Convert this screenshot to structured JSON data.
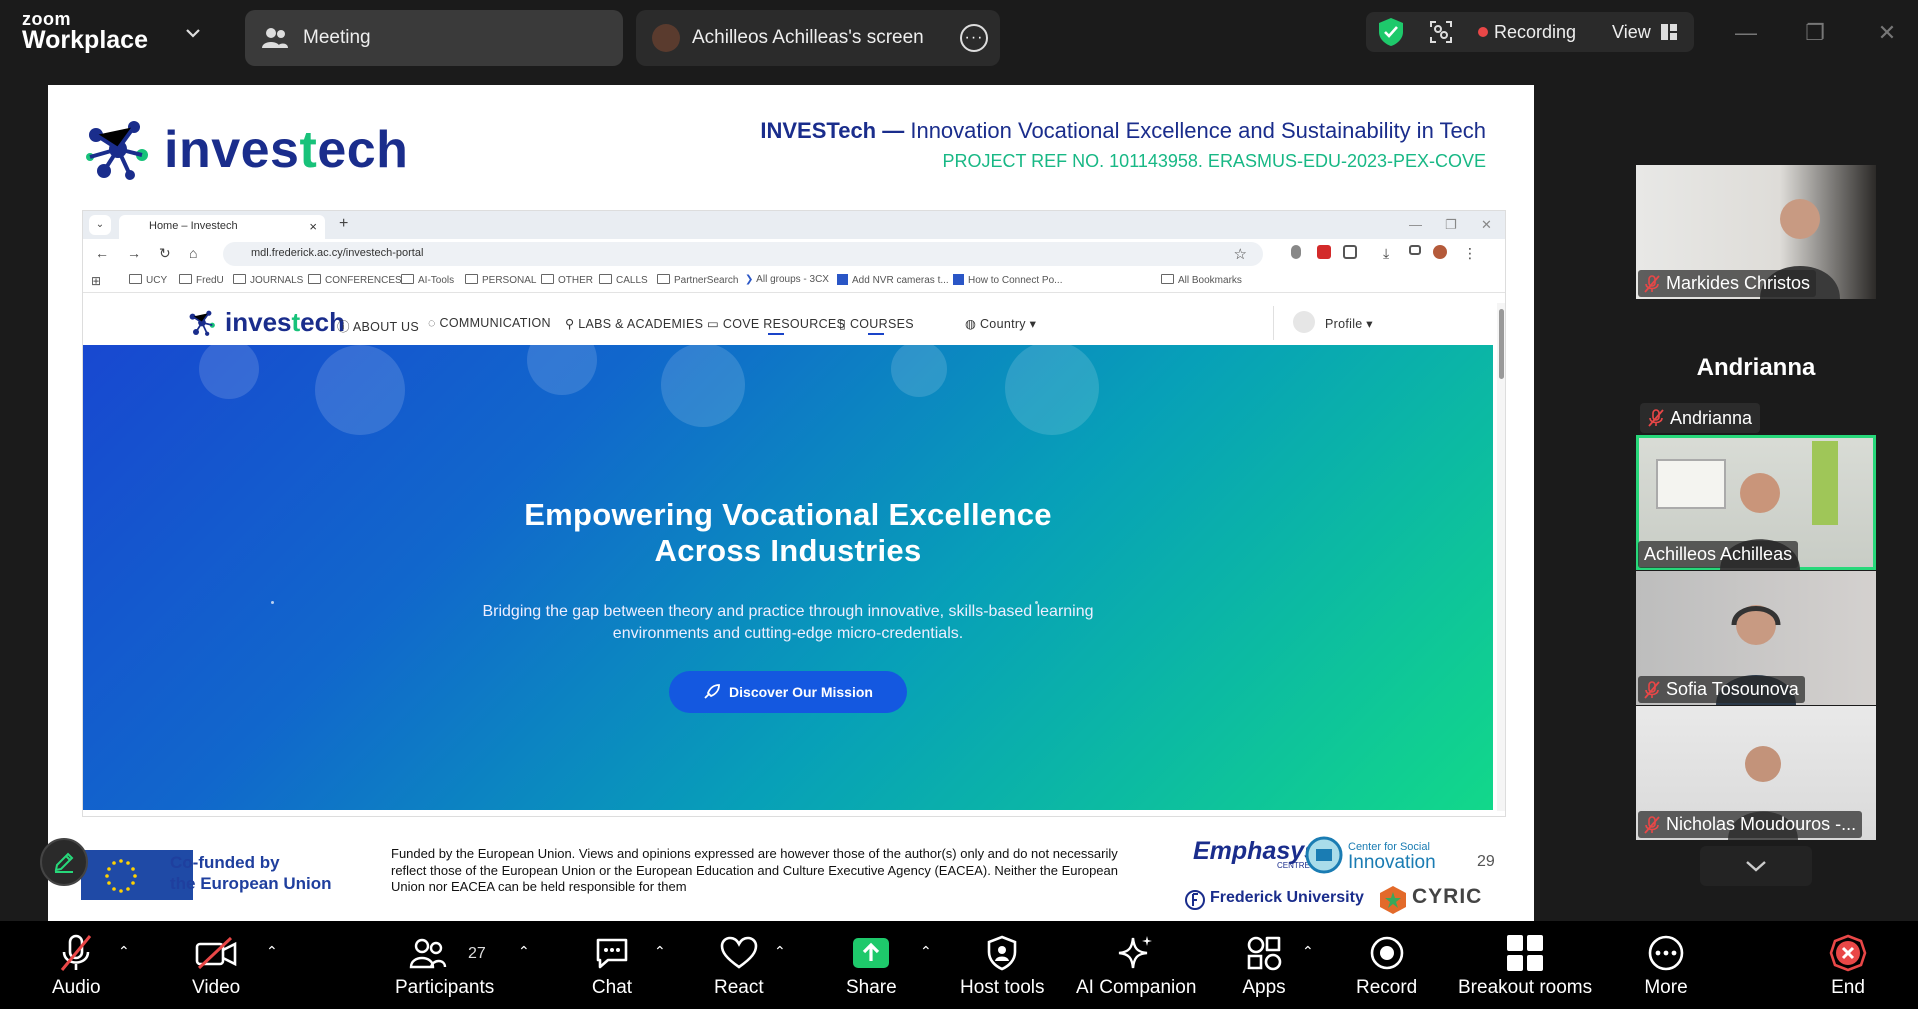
{
  "zoom": {
    "brand_top": "zoom",
    "brand_bottom": "Workplace",
    "meeting_tab_label": "Meeting",
    "screen_tab_label": "Achilleos Achilleas's screen",
    "recording_label": "Recording",
    "view_label": "View"
  },
  "slide": {
    "logo_text_a": "inves",
    "logo_text_b": "t",
    "logo_text_c": "ech",
    "header_title_bold": "INVESTech —",
    "header_title_rest": " Innovation Vocational Excellence and Sustainability in Tech",
    "header_sub": "PROJECT REF NO. 101143958. ERASMUS-EDU-2023-PEX-COVE",
    "eu_line1": "Co-funded by",
    "eu_line2": "the European Union",
    "disclaimer": "Funded by the European Union. Views and opinions expressed are however those of the author(s) only and do not necessarily reflect those of the European Union or the European Education and Culture Executive Agency (EACEA). Neither the European Union nor EACEA can be held responsible for them",
    "partner1": "Emphasys",
    "partner1_sub": "CENTRE",
    "partner2_top": "Center for Social",
    "partner2_main": "Innovation",
    "partner2_num": "29",
    "partner3": "Frederick University",
    "partner4": "CYRIC"
  },
  "browser": {
    "tab_title": "Home – Investech",
    "url": "mdl.frederick.ac.cy/investech-portal",
    "bookmarks": [
      "UCY",
      "FredU",
      "JOURNALS",
      "CONFERENCES",
      "AI-Tools",
      "PERSONAL",
      "OTHER",
      "CALLS",
      "PartnerSearch",
      "All groups - 3CX",
      "Add NVR cameras t...",
      "How to Connect Po...",
      "All Bookmarks"
    ]
  },
  "site": {
    "logo_a": "inves",
    "logo_b": "t",
    "logo_c": "ech",
    "nav": [
      "ABOUT US",
      "COMMUNICATION",
      "LABS & ACADEMIES",
      "COVE RESOURCES",
      "COURSES"
    ],
    "country": "Country",
    "profile": "Profile",
    "hero_title_1": "Empowering Vocational Excellence",
    "hero_title_2": "Across Industries",
    "hero_desc_1": "Bridging the gap between theory and practice through innovative, skills-based learning",
    "hero_desc_2": "environments and cutting-edge micro-credentials.",
    "hero_button": "Discover Our Mission"
  },
  "participants_panel": {
    "big_name": "Andrianna",
    "tiles": [
      {
        "name": "Markides Christos"
      },
      {
        "name": "Andrianna"
      },
      {
        "name": "Achilleos Achilleas"
      },
      {
        "name": "Sofia Tosounova"
      },
      {
        "name": "Nicholas Moudouros -..."
      }
    ]
  },
  "toolbar": {
    "audio": "Audio",
    "video": "Video",
    "participants": "Participants",
    "participants_count": "27",
    "chat": "Chat",
    "react": "React",
    "share": "Share",
    "host_tools": "Host tools",
    "ai_companion": "AI Companion",
    "apps": "Apps",
    "record": "Record",
    "breakout": "Breakout rooms",
    "more": "More",
    "end": "End"
  },
  "colors": {
    "accent_green": "#27d87a",
    "share_green": "#1ec96b",
    "end_red": "#e94747",
    "brand_navy": "#1a2d8c",
    "brand_teal": "#18c27a"
  }
}
